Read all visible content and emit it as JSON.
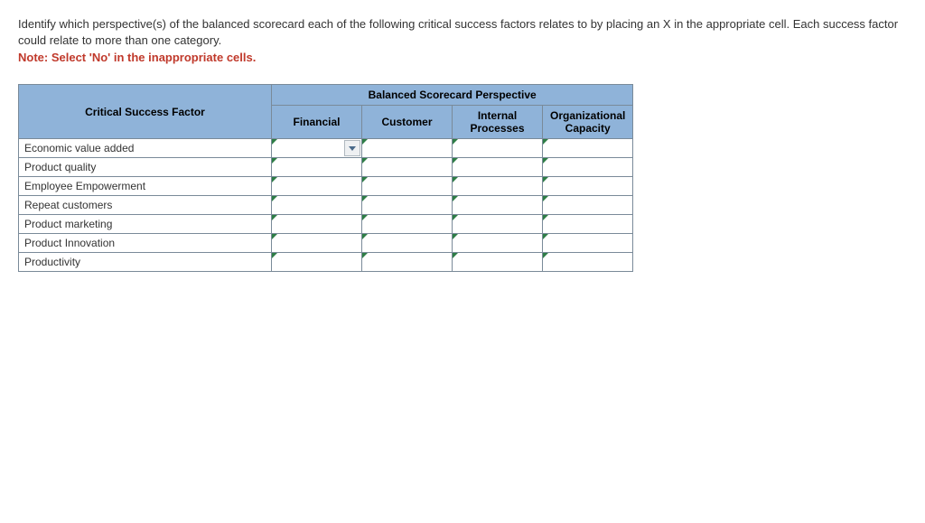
{
  "instructions": {
    "line1": "Identify which perspective(s) of the balanced scorecard each of the following critical success factors relates to by placing an X in the appropriate cell. Each success factor could relate to more than one category.",
    "note": "Note: Select 'No' in the inappropriate cells."
  },
  "table": {
    "factor_header": "Critical Success Factor",
    "super_header": "Balanced Scorecard Perspective",
    "columns": [
      "Financial",
      "Customer",
      "Internal Processes",
      "Organizational Capacity"
    ],
    "rows": [
      "Economic value added",
      "Product quality",
      "Employee Empowerment",
      "Repeat customers",
      "Product marketing",
      "Product Innovation",
      "Productivity"
    ],
    "active_dropdown": {
      "row": 0,
      "col": 0
    }
  }
}
